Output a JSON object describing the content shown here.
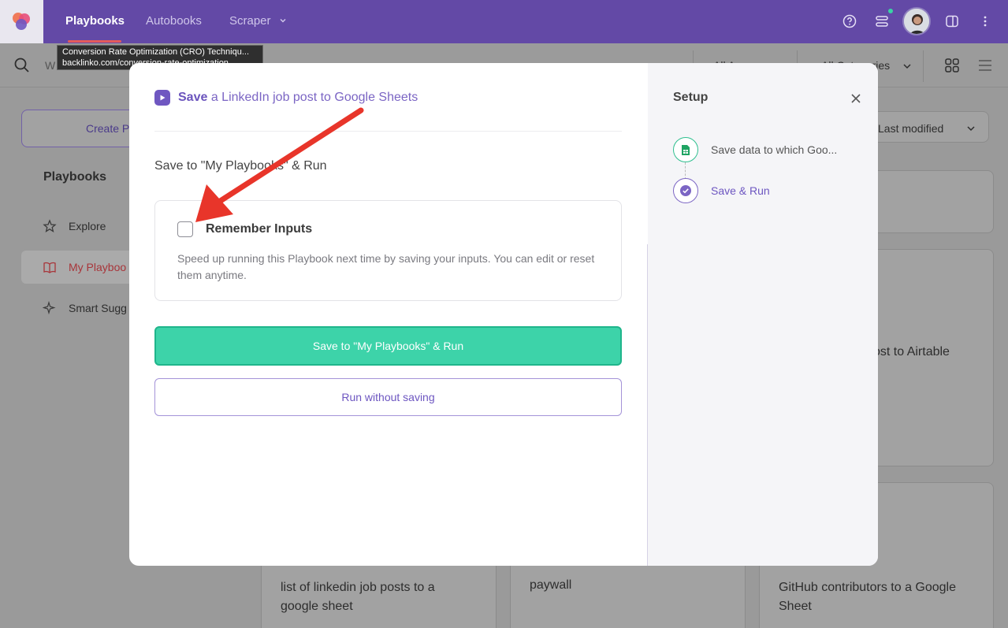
{
  "topbar": {
    "nav": [
      {
        "label": "Playbooks",
        "active": true
      },
      {
        "label": "Autobooks",
        "active": false
      },
      {
        "label": "Scraper",
        "active": false
      }
    ],
    "icons": [
      "help-icon",
      "layers-icon",
      "avatar",
      "sidebar-toggle-icon",
      "more-vertical-icon"
    ]
  },
  "tooltip": {
    "title": "Conversion Rate Optimization (CRO) Techniqu...",
    "url": "backlinko.com/conversion-rate-optimization"
  },
  "background": {
    "search_placeholder": "W",
    "filter1": "All A",
    "filter2": "All Categories",
    "sort": "Last modified",
    "create_button": "Create P",
    "sidebar_heading": "Playbooks",
    "sidebar_items": [
      "Explore",
      "My Playboo",
      "Smart Sugg"
    ],
    "card_texts": [
      "ost to Airtable",
      "list of linkedin job posts to a google sheet",
      "paywall",
      "GitHub contributors to a Google Sheet"
    ]
  },
  "modal": {
    "title_bold": "Save",
    "title_rest": "a LinkedIn job post to Google Sheets",
    "section_title": "Save to \"My Playbooks\" & Run",
    "remember": {
      "label": "Remember Inputs",
      "checked": false,
      "description": "Speed up running this Playbook next time by saving your inputs. You can edit or reset them anytime."
    },
    "primary_button": "Save to \"My Playbooks\" & Run",
    "secondary_button": "Run without saving"
  },
  "setup": {
    "title": "Setup",
    "steps": [
      {
        "label": "Save data to which Goo...",
        "icon": "sheets-icon",
        "active": false
      },
      {
        "label": "Save & Run",
        "icon": "check-circle-icon",
        "active": true
      }
    ]
  },
  "colors": {
    "brand": "#6349a6",
    "accent_green": "#3dd3a9",
    "accent_purple": "#6d56c1",
    "annotation_red": "#e8352a"
  }
}
